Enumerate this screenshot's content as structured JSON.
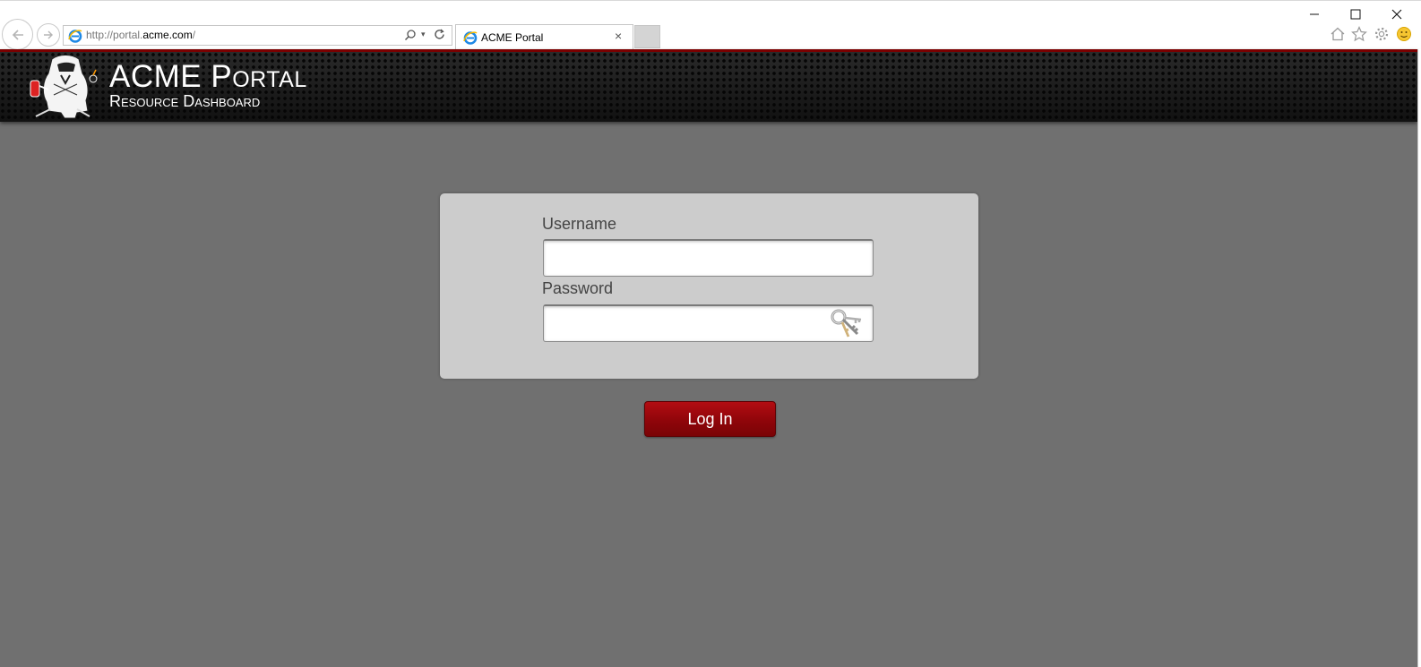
{
  "browser": {
    "url_prefix": "http://portal.",
    "url_domain": "acme.com",
    "url_suffix": "/",
    "tab_title": "ACME Portal",
    "tab_close": "×",
    "dropdown_glyph": "▾"
  },
  "header": {
    "title": "ACME Portal",
    "subtitle": "Resource Dashboard"
  },
  "login": {
    "username_label": "Username",
    "username_value": "",
    "password_label": "Password",
    "password_value": "",
    "button_label": "Log In"
  },
  "colors": {
    "page_background": "#707070",
    "panel_background": "#cccccc",
    "button_red": "#9b070c",
    "banner_dark": "#1d1d1d",
    "banner_accent": "#7a0000"
  },
  "icons": {
    "back": "back-arrow-icon",
    "forward": "forward-arrow-icon",
    "ie": "ie-logo-icon",
    "search": "search-icon",
    "refresh": "refresh-icon",
    "home": "home-icon",
    "favorites": "star-icon",
    "settings": "gear-icon",
    "feedback": "smiley-icon",
    "keys": "keys-icon",
    "logo": "spy-mascot-logo"
  }
}
